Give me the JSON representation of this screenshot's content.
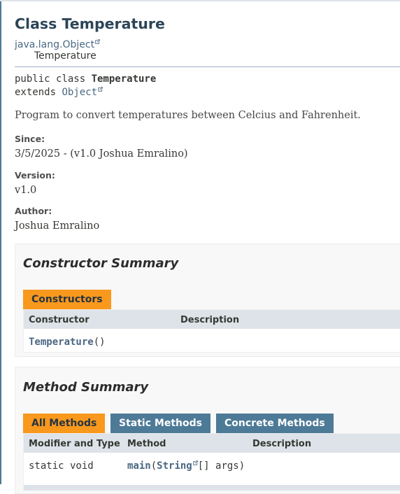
{
  "header": {
    "title": "Class Temperature",
    "inheritance": [
      "java.lang.Object",
      "Temperature"
    ]
  },
  "signature": {
    "line1_prefix": "public class ",
    "class_name": "Temperature",
    "line2_prefix": "extends ",
    "superclass": "Object"
  },
  "description": "Program to convert temperatures between Celcius and Fahrenheit.",
  "tags": {
    "since_label": "Since:",
    "since_value": "3/5/2025 - (v1.0 Joshua Emralino)",
    "version_label": "Version:",
    "version_value": "v1.0",
    "author_label": "Author:",
    "author_value": "Joshua Emralino"
  },
  "constructor_summary": {
    "heading": "Constructor Summary",
    "tab": "Constructors",
    "columns": [
      "Constructor",
      "Description"
    ],
    "rows": [
      {
        "name": "Temperature",
        "params": "()",
        "description": ""
      }
    ]
  },
  "method_summary": {
    "heading": "Method Summary",
    "tabs": [
      "All Methods",
      "Static Methods",
      "Concrete Methods"
    ],
    "active_tab": "All Methods",
    "columns": [
      "Modifier and Type",
      "Method",
      "Description"
    ],
    "rows": [
      {
        "modifier": "static void",
        "name": "main",
        "open": "(",
        "param_type": "String",
        "rest": "[] args)",
        "description": ""
      }
    ]
  },
  "colors": {
    "accent_tab": "#f8981d",
    "inactive_tab": "#4d7a97",
    "table_header": "#dee3e9",
    "link": "#4a6782"
  }
}
